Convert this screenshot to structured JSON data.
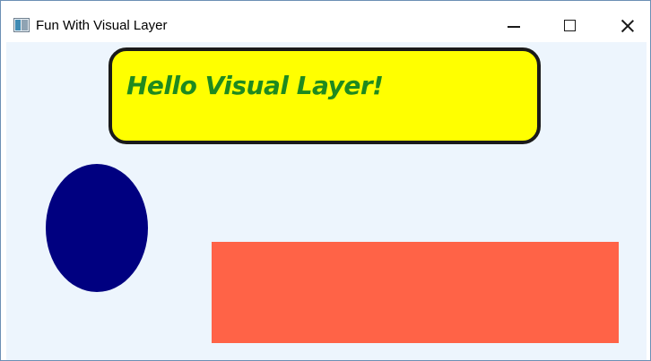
{
  "window": {
    "title": "Fun With Visual Layer",
    "icon": "app-window-icon",
    "controls": {
      "minimize": "minimize-icon",
      "maximize": "maximize-icon",
      "close": "close-icon"
    }
  },
  "canvas": {
    "background_color": "#edf5fd",
    "callout": {
      "text": "Hello Visual Layer!",
      "fill_color": "#ffff00",
      "border_color": "#1a1a1a",
      "text_color": "#1f8a1f"
    },
    "ellipse": {
      "fill_color": "#000080"
    },
    "rectangle": {
      "fill_color": "#ff6347"
    }
  }
}
